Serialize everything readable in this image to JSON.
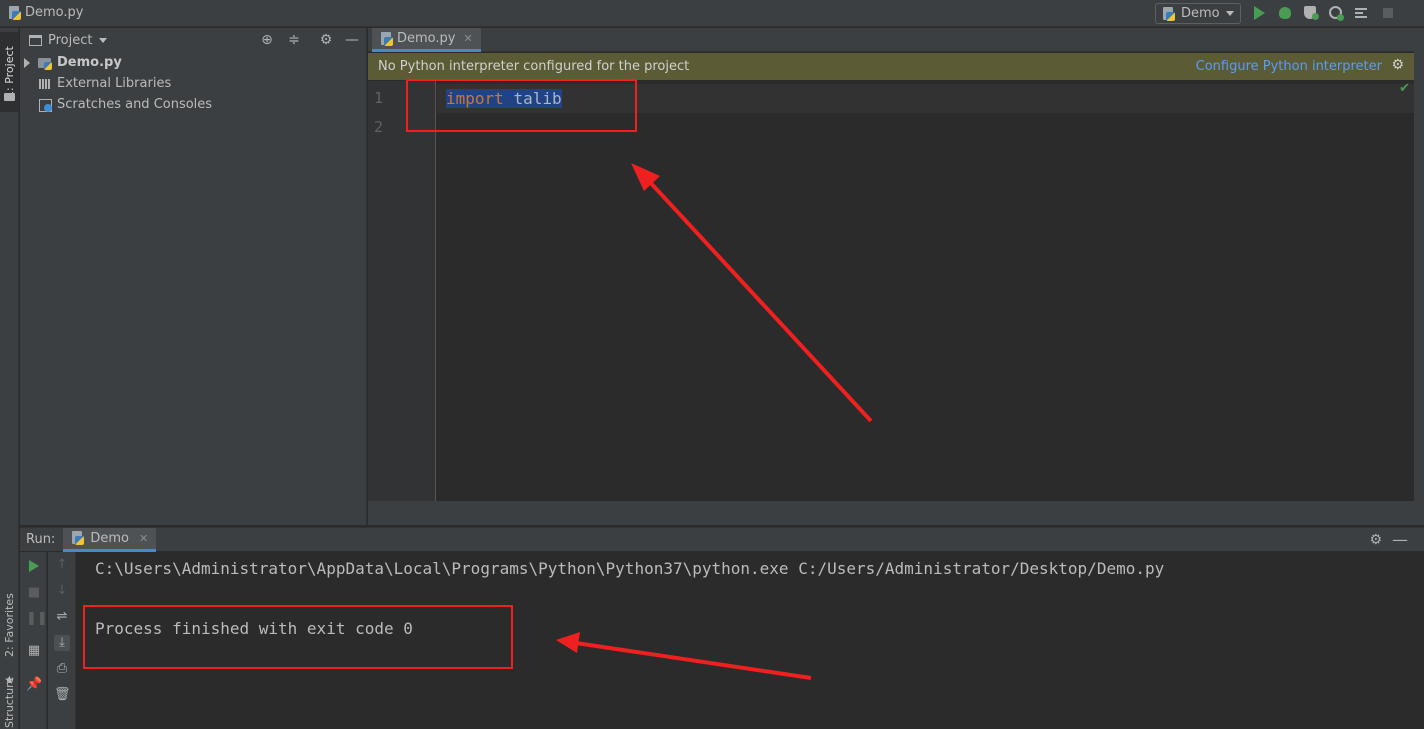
{
  "window": {
    "title": "Demo.py"
  },
  "toolbar": {
    "run_config": "Demo",
    "icons": [
      "run-icon",
      "debug-icon",
      "coverage-icon",
      "profile-icon",
      "concurrency-icon",
      "stop-icon"
    ]
  },
  "left_strip": {
    "project_tab": "1: Project",
    "favorites_tab": "2: Favorites",
    "structure_tab": "Structure"
  },
  "project_panel": {
    "title": "Project",
    "items": [
      {
        "label": "Demo.py",
        "icon": "python-folder-icon"
      },
      {
        "label": "External Libraries",
        "icon": "libraries-icon"
      },
      {
        "label": "Scratches and Consoles",
        "icon": "scratches-icon"
      }
    ]
  },
  "editor": {
    "tab_label": "Demo.py",
    "banner_text": "No Python interpreter configured for the project",
    "banner_link": "Configure Python interpreter",
    "line_numbers": [
      "1",
      "2"
    ],
    "code_keyword": "import",
    "code_module": "talib"
  },
  "run_panel": {
    "label": "Run:",
    "tab_label": "Demo",
    "console_lines": [
      "C:\\Users\\Administrator\\AppData\\Local\\Programs\\Python\\Python37\\python.exe C:/Users/Administrator/Desktop/Demo.py",
      "Process finished with exit code 0"
    ]
  },
  "colors": {
    "background": "#2b2b2b",
    "panel": "#3c3f41",
    "banner": "#5b5b35",
    "link": "#589df6",
    "keyword": "#cc7832",
    "selection": "#214283",
    "annotation_red": "#ee2020",
    "run_green": "#499c54"
  }
}
